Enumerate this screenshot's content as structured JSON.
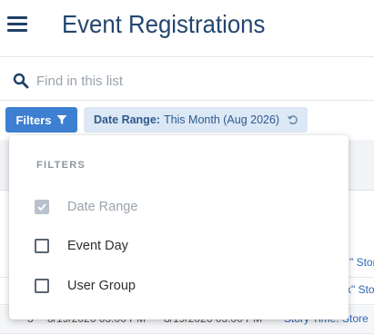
{
  "header": {
    "title": "Event Registrations"
  },
  "search": {
    "placeholder": "Find in this list"
  },
  "filter_bar": {
    "filters_label": "Filters",
    "chip_key": "Date Range:",
    "chip_value": "This Month (Aug 2026)"
  },
  "table": {
    "rows": [
      {
        "num": "",
        "col_a": "",
        "col_b": "",
        "event": "\" Stor"
      },
      {
        "num": "",
        "col_a": "",
        "col_b": "",
        "event": "k\" Sto"
      },
      {
        "num": "3",
        "col_a": "8/19/2026 03:00 PM",
        "col_b": "8/19/2026 03:00 PM",
        "event": "Story Time: Store"
      }
    ]
  },
  "filter_panel": {
    "heading": "FILTERS",
    "options": [
      {
        "label": "Date Range",
        "checked": true,
        "disabled": true
      },
      {
        "label": "Event Day",
        "checked": false,
        "disabled": false
      },
      {
        "label": "User Group",
        "checked": false,
        "disabled": false
      }
    ]
  },
  "colors": {
    "accent": "#3d7fd0",
    "title": "#23466f",
    "chip_bg": "#dde8f6"
  },
  "icons": {
    "menu": "hamburger-menu-icon",
    "search": "search-icon",
    "filter": "funnel-icon",
    "reset": "reset-icon",
    "check": "checkmark-icon"
  }
}
